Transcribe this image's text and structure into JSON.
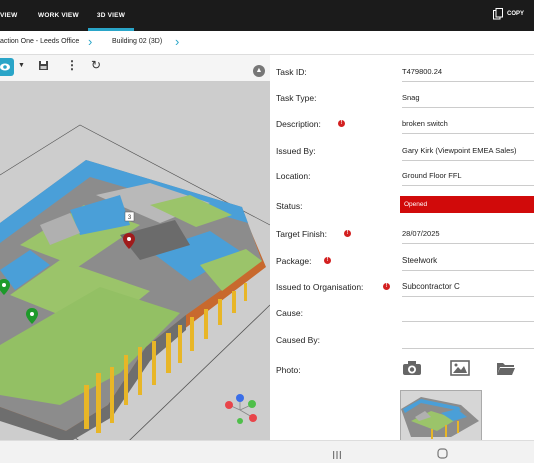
{
  "topbar": {
    "tabs": [
      {
        "label": "VIEW"
      },
      {
        "label": "WORK VIEW"
      },
      {
        "label": "3D VIEW"
      }
    ],
    "copy_label": "COPY"
  },
  "breadcrumb": {
    "items": [
      "action One - Leeds Office",
      "Building 02 (3D)"
    ]
  },
  "viewer": {
    "pin_label": "3"
  },
  "form": {
    "fields": [
      {
        "label": "Task ID:",
        "value": "T479800.24"
      },
      {
        "label": "Task Type:",
        "value": "Snag"
      },
      {
        "label": "Description:",
        "value": "broken switch"
      },
      {
        "label": "Issued By:",
        "value": "Gary Kirk (Viewpoint EMEA Sales)"
      },
      {
        "label": "Location:",
        "value": "Ground Floor FFL"
      },
      {
        "label": "Status:",
        "value": "Opened"
      },
      {
        "label": "Target Finish:",
        "value": "28/07/2025"
      },
      {
        "label": "Package:",
        "value": "Steelwork"
      },
      {
        "label": "Issued to Organisation:",
        "value": "Subcontractor C"
      },
      {
        "label": "Cause:",
        "value": ""
      },
      {
        "label": "Caused By:",
        "value": ""
      },
      {
        "label": "Photo:",
        "value": ""
      }
    ],
    "status_color": "#d10a0a"
  },
  "colors": {
    "accent": "#2aa5c8",
    "topbar": "#1b1b1b"
  }
}
